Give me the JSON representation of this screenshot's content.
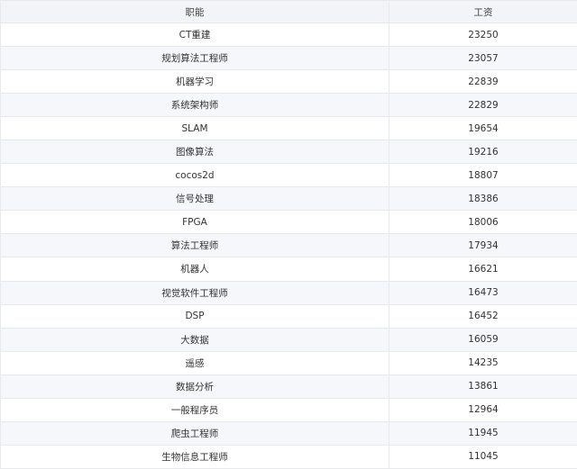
{
  "chart_data": {
    "type": "table",
    "columns": [
      "职能",
      "工资"
    ],
    "rows": [
      [
        "CT重建",
        "23250"
      ],
      [
        "规划算法工程师",
        "23057"
      ],
      [
        "机器学习",
        "22839"
      ],
      [
        "系统架构师",
        "22829"
      ],
      [
        "SLAM",
        "19654"
      ],
      [
        "图像算法",
        "19216"
      ],
      [
        "cocos2d",
        "18807"
      ],
      [
        "信号处理",
        "18386"
      ],
      [
        "FPGA",
        "18006"
      ],
      [
        "算法工程师",
        "17934"
      ],
      [
        "机器人",
        "16621"
      ],
      [
        "视觉软件工程师",
        "16473"
      ],
      [
        "DSP",
        "16452"
      ],
      [
        "大数据",
        "16059"
      ],
      [
        "遥感",
        "14235"
      ],
      [
        "数据分析",
        "13861"
      ],
      [
        "一般程序员",
        "12964"
      ],
      [
        "爬虫工程师",
        "11945"
      ],
      [
        "生物信息工程师",
        "11045"
      ]
    ]
  }
}
